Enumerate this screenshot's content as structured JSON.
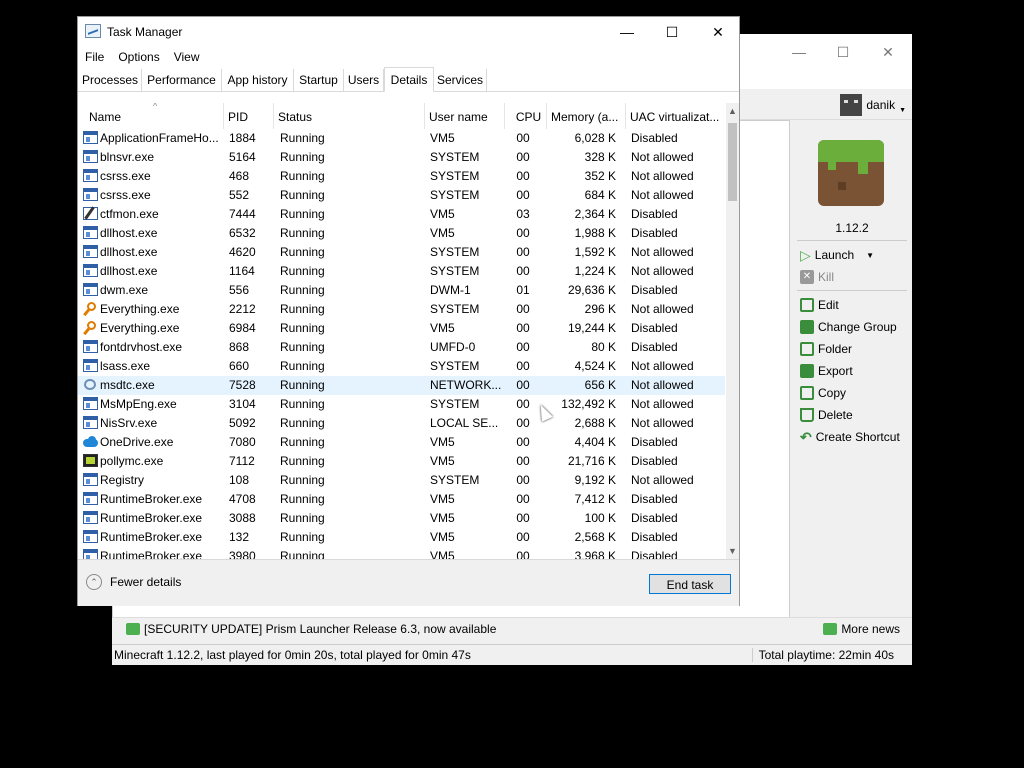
{
  "launcher": {
    "user": "danik",
    "instance_version": "1.12.2",
    "actions": [
      {
        "label": "Launch",
        "enabled": true,
        "icon": "play-icon"
      },
      {
        "label": "Kill",
        "enabled": false,
        "icon": "close-icon"
      },
      {
        "label": "Edit",
        "enabled": true,
        "icon": "edit-icon"
      },
      {
        "label": "Change Group",
        "enabled": true,
        "icon": "tag-icon"
      },
      {
        "label": "Folder",
        "enabled": true,
        "icon": "folder-icon"
      },
      {
        "label": "Export",
        "enabled": true,
        "icon": "export-icon"
      },
      {
        "label": "Copy",
        "enabled": true,
        "icon": "copy-icon"
      },
      {
        "label": "Delete",
        "enabled": true,
        "icon": "trash-icon"
      },
      {
        "label": "Create Shortcut",
        "enabled": true,
        "icon": "shortcut-icon"
      }
    ],
    "news": "[SECURITY UPDATE] Prism Launcher Release 6.3, now available",
    "more_news": "More news",
    "status_left": "Minecraft 1.12.2, last played for 0min 20s, total played for 0min 47s",
    "status_right": "Total playtime: 22min 40s"
  },
  "taskmanager": {
    "title": "Task Manager",
    "controls": {
      "minimize": "—",
      "maximize": "☐",
      "close": "✕"
    },
    "menu": [
      "File",
      "Options",
      "View"
    ],
    "tabs": [
      "Processes",
      "Performance",
      "App history",
      "Startup",
      "Users",
      "Details",
      "Services"
    ],
    "active_tab": "Details",
    "columns": [
      "Name",
      "PID",
      "Status",
      "User name",
      "CPU",
      "Memory (a...",
      "UAC virtualizat..."
    ],
    "rows": [
      {
        "icon": "exe",
        "name": "ApplicationFrameHo...",
        "pid": "1884",
        "status": "Running",
        "user": "VM5",
        "cpu": "00",
        "mem": "6,028 K",
        "uac": "Disabled"
      },
      {
        "icon": "exe",
        "name": "blnsvr.exe",
        "pid": "5164",
        "status": "Running",
        "user": "SYSTEM",
        "cpu": "00",
        "mem": "328 K",
        "uac": "Not allowed"
      },
      {
        "icon": "exe",
        "name": "csrss.exe",
        "pid": "468",
        "status": "Running",
        "user": "SYSTEM",
        "cpu": "00",
        "mem": "352 K",
        "uac": "Not allowed"
      },
      {
        "icon": "exe",
        "name": "csrss.exe",
        "pid": "552",
        "status": "Running",
        "user": "SYSTEM",
        "cpu": "00",
        "mem": "684 K",
        "uac": "Not allowed"
      },
      {
        "icon": "pen",
        "name": "ctfmon.exe",
        "pid": "7444",
        "status": "Running",
        "user": "VM5",
        "cpu": "03",
        "mem": "2,364 K",
        "uac": "Disabled"
      },
      {
        "icon": "exe",
        "name": "dllhost.exe",
        "pid": "6532",
        "status": "Running",
        "user": "VM5",
        "cpu": "00",
        "mem": "1,988 K",
        "uac": "Disabled"
      },
      {
        "icon": "exe",
        "name": "dllhost.exe",
        "pid": "4620",
        "status": "Running",
        "user": "SYSTEM",
        "cpu": "00",
        "mem": "1,592 K",
        "uac": "Not allowed"
      },
      {
        "icon": "exe",
        "name": "dllhost.exe",
        "pid": "1164",
        "status": "Running",
        "user": "SYSTEM",
        "cpu": "00",
        "mem": "1,224 K",
        "uac": "Not allowed"
      },
      {
        "icon": "exe",
        "name": "dwm.exe",
        "pid": "556",
        "status": "Running",
        "user": "DWM-1",
        "cpu": "01",
        "mem": "29,636 K",
        "uac": "Disabled"
      },
      {
        "icon": "key",
        "name": "Everything.exe",
        "pid": "2212",
        "status": "Running",
        "user": "SYSTEM",
        "cpu": "00",
        "mem": "296 K",
        "uac": "Not allowed"
      },
      {
        "icon": "key",
        "name": "Everything.exe",
        "pid": "6984",
        "status": "Running",
        "user": "VM5",
        "cpu": "00",
        "mem": "19,244 K",
        "uac": "Disabled"
      },
      {
        "icon": "exe",
        "name": "fontdrvhost.exe",
        "pid": "868",
        "status": "Running",
        "user": "UMFD-0",
        "cpu": "00",
        "mem": "80 K",
        "uac": "Disabled"
      },
      {
        "icon": "exe",
        "name": "lsass.exe",
        "pid": "660",
        "status": "Running",
        "user": "SYSTEM",
        "cpu": "00",
        "mem": "4,524 K",
        "uac": "Not allowed"
      },
      {
        "icon": "net",
        "name": "msdtc.exe",
        "pid": "7528",
        "status": "Running",
        "user": "NETWORK...",
        "cpu": "00",
        "mem": "656 K",
        "uac": "Not allowed",
        "selected": true
      },
      {
        "icon": "exe",
        "name": "MsMpEng.exe",
        "pid": "3104",
        "status": "Running",
        "user": "SYSTEM",
        "cpu": "00",
        "mem": "132,492 K",
        "uac": "Not allowed"
      },
      {
        "icon": "exe",
        "name": "NisSrv.exe",
        "pid": "5092",
        "status": "Running",
        "user": "LOCAL SE...",
        "cpu": "00",
        "mem": "2,688 K",
        "uac": "Not allowed"
      },
      {
        "icon": "cloud",
        "name": "OneDrive.exe",
        "pid": "7080",
        "status": "Running",
        "user": "VM5",
        "cpu": "00",
        "mem": "4,404 K",
        "uac": "Disabled"
      },
      {
        "icon": "poly",
        "name": "pollymc.exe",
        "pid": "7112",
        "status": "Running",
        "user": "VM5",
        "cpu": "00",
        "mem": "21,716 K",
        "uac": "Disabled"
      },
      {
        "icon": "exe",
        "name": "Registry",
        "pid": "108",
        "status": "Running",
        "user": "SYSTEM",
        "cpu": "00",
        "mem": "9,192 K",
        "uac": "Not allowed"
      },
      {
        "icon": "exe",
        "name": "RuntimeBroker.exe",
        "pid": "4708",
        "status": "Running",
        "user": "VM5",
        "cpu": "00",
        "mem": "7,412 K",
        "uac": "Disabled"
      },
      {
        "icon": "exe",
        "name": "RuntimeBroker.exe",
        "pid": "3088",
        "status": "Running",
        "user": "VM5",
        "cpu": "00",
        "mem": "100 K",
        "uac": "Disabled"
      },
      {
        "icon": "exe",
        "name": "RuntimeBroker.exe",
        "pid": "132",
        "status": "Running",
        "user": "VM5",
        "cpu": "00",
        "mem": "2,568 K",
        "uac": "Disabled"
      },
      {
        "icon": "exe",
        "name": "RuntimeBroker.exe",
        "pid": "3980",
        "status": "Running",
        "user": "VM5",
        "cpu": "00",
        "mem": "3,968 K",
        "uac": "Disabled"
      }
    ],
    "fewer_details": "Fewer details",
    "end_task": "End task"
  }
}
